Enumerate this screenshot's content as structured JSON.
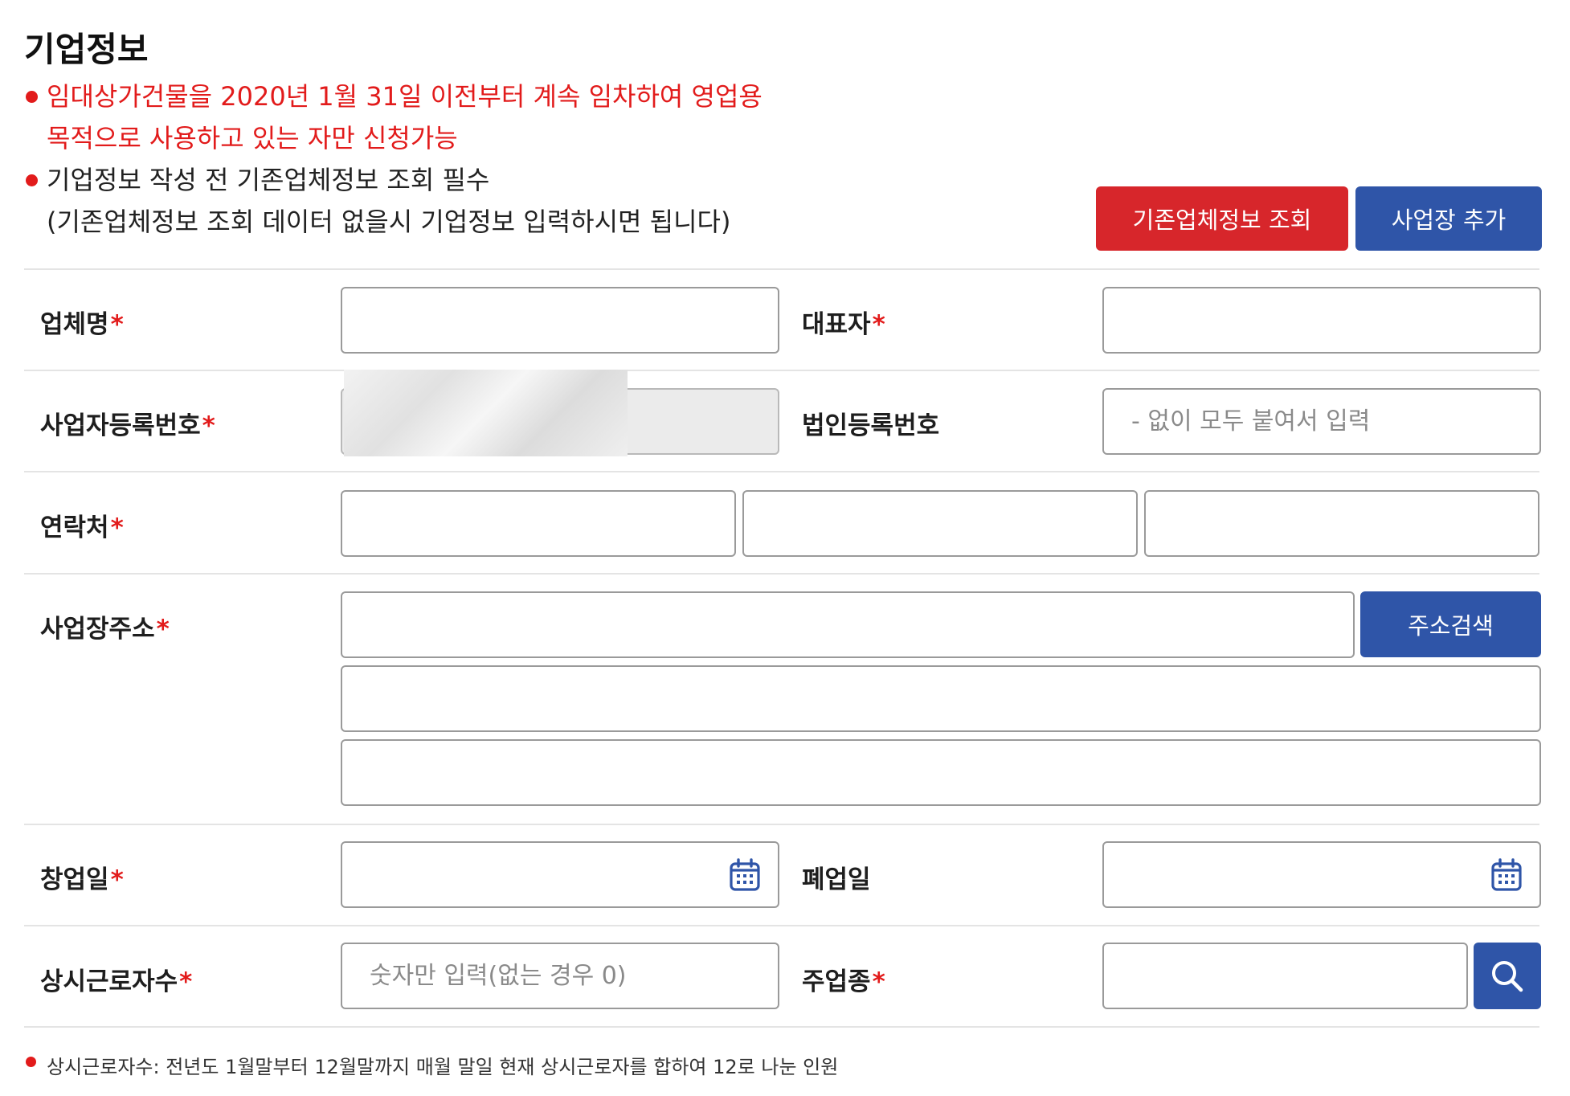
{
  "section_title": "기업정보",
  "notes": [
    {
      "line1": "임대상가건물을 2020년 1월 31일 이전부터 계속 임차하여 영업용",
      "line2": "목적으로 사용하고 있는 자만 신청가능"
    },
    {
      "line1": "기업정보 작성 전 기존업체정보 조회 필수",
      "line2": "(기존업체정보 조회 데이터 없을시 기업정보 입력하시면 됩니다)"
    }
  ],
  "buttons": {
    "lookup": "기존업체정보 조회",
    "add_site": "사업장 추가",
    "address_search": "주소검색"
  },
  "labels": {
    "company_name": "업체명",
    "representative": "대표자",
    "business_reg_no": "사업자등록번호",
    "corp_reg_no": "법인등록번호",
    "contact": "연락처",
    "address": "사업장주소",
    "founded_date": "창업일",
    "closed_date": "폐업일",
    "employees": "상시근로자수",
    "main_industry": "주업종"
  },
  "required_mark": "*",
  "placeholders": {
    "corp_reg_no": "- 없이 모두 붙여서 입력",
    "employees": "숫자만 입력(없는 경우 0)"
  },
  "footnote": "상시근로자수: 전년도 1월말부터 12월말까지 매월 말일 현재 상시근로자를 합하여 12로 나눈 인원",
  "colors": {
    "accent_red": "#d7262b",
    "accent_blue": "#2f55a8",
    "notice_red": "#e21b1b"
  },
  "icons": {
    "calendar": "calendar-icon",
    "search": "search-icon",
    "bullet": "bullet-dot"
  }
}
